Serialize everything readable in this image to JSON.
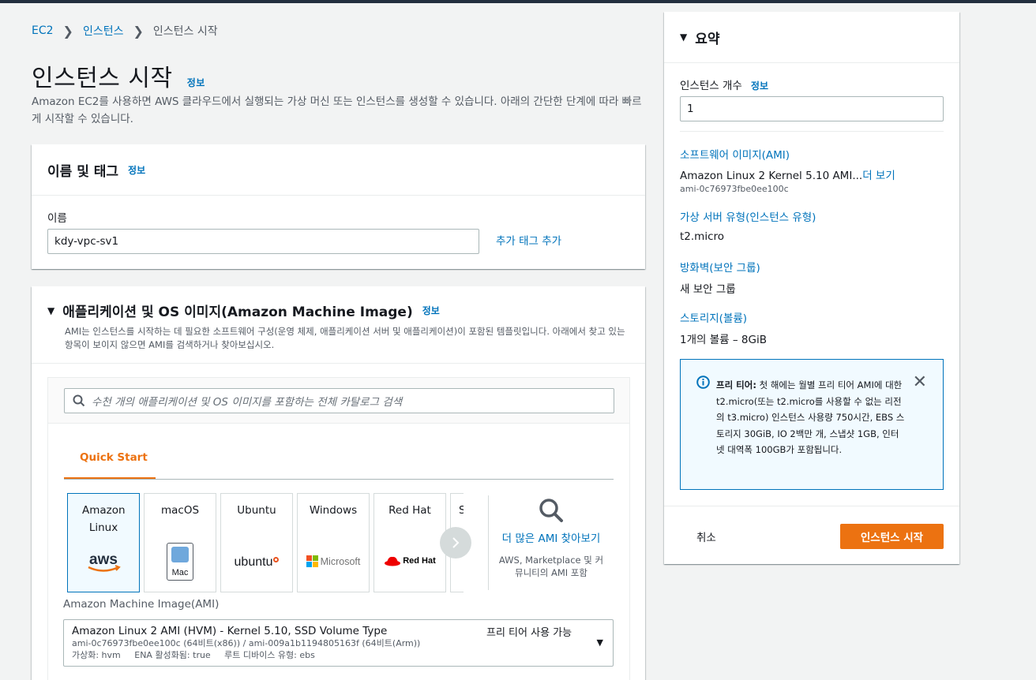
{
  "breadcrumb": {
    "items": [
      "EC2",
      "인스턴스",
      "인스턴스 시작"
    ]
  },
  "page": {
    "title": "인스턴스 시작",
    "info": "정보",
    "description": "Amazon EC2를 사용하면 AWS 클라우드에서 실행되는 가상 머신 또는 인스턴스를 생성할 수 있습니다. 아래의 간단한 단계에 따라 빠르게 시작할 수 있습니다."
  },
  "name_tags": {
    "title": "이름 및 태그",
    "info": "정보",
    "name_label": "이름",
    "name_value": "kdy-vpc-sv1",
    "add_tag": "추가 태그 추가"
  },
  "ami": {
    "title": "애플리케이션 및 OS 이미지(Amazon Machine Image)",
    "info": "정보",
    "description": "AMI는 인스턴스를 시작하는 데 필요한 소프트웨어 구성(운영 체제, 애플리케이션 서버 및 애플리케이션)이 포함된 템플릿입니다. 아래에서 찾고 있는 항목이 보이지 않으면 AMI를 검색하거나 찾아보십시오.",
    "search_placeholder": "수천 개의 애플리케이션 및 OS 이미지를 포함하는 전체 카탈로그 검색",
    "tab": "Quick Start",
    "os_options": [
      {
        "label": "Amazon Linux",
        "logo": "aws"
      },
      {
        "label": "macOS",
        "logo": "Mac"
      },
      {
        "label": "Ubuntu",
        "logo": "ubuntu"
      },
      {
        "label": "Windows",
        "logo": "Microsoft"
      },
      {
        "label": "Red Hat",
        "logo": "Red Hat"
      },
      {
        "label": "S",
        "logo": ""
      }
    ],
    "more_title": "더 많은 AMI 찾아보기",
    "more_sub": "AWS, Marketplace 및 커뮤니티의 AMI 포함",
    "select_label": "Amazon Machine Image(AMI)",
    "selected_name": "Amazon Linux 2 AMI (HVM) - Kernel 5.10, SSD Volume Type",
    "selected_ids": "ami-0c76973fbe0ee100c (64비트(x86)) / ami-009a1b1194805163f (64비트(Arm))",
    "selected_meta": "가상화: hvm     ENA 활성화됨: true     루트 디바이스 유형: ebs",
    "free_tier": "프리 티어 사용 가능"
  },
  "summary": {
    "title": "요약",
    "count_label": "인스턴스 개수",
    "count_info": "정보",
    "count_value": "1",
    "software_label": "소프트웨어 이미지(AMI)",
    "software_value": "Amazon Linux 2 Kernel 5.10 AMI...",
    "software_more": "더 보기",
    "software_id": "ami-0c76973fbe0ee100c",
    "type_label": "가상 서버 유형(인스턴스 유형)",
    "type_value": "t2.micro",
    "firewall_label": "방화벽(보안 그룹)",
    "firewall_value": "새 보안 그룹",
    "storage_label": "스토리지(볼륨)",
    "storage_value": "1개의 볼륨 – 8GiB",
    "free_tier_bold": "프리 티어:",
    "free_tier_text": " 첫 해에는 월별 프리 티어 AMI에 대한 t2.micro(또는 t2.micro를 사용할 수 없는 리전의 t3.micro) 인스턴스 사용량 750시간, EBS 스토리지 30GiB, IO 2백만 개, 스냅샷 1GB, 인터넷 대역폭 100GB가 포함됩니다.",
    "cancel": "취소",
    "launch": "인스턴스 시작"
  },
  "colors": {
    "accent": "#ec7211",
    "link": "#0073bb",
    "header": "#232f3e"
  }
}
